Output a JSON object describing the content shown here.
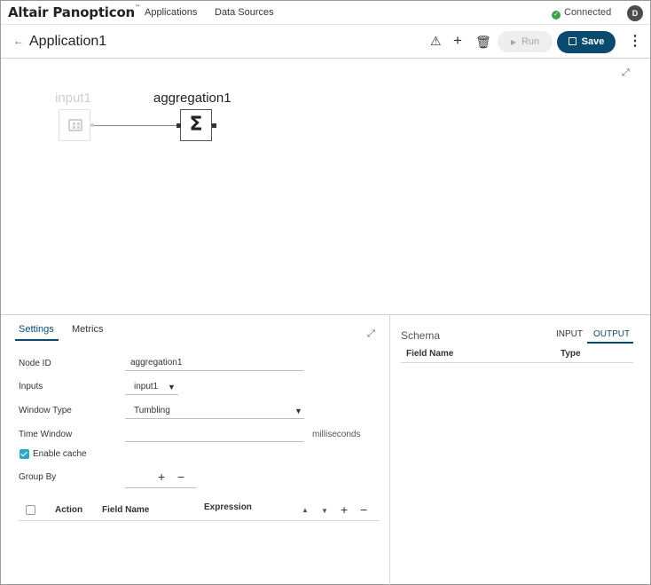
{
  "topbar": {
    "logo": "Altair Panopticon",
    "logo_mark": "™",
    "nav": [
      "Applications",
      "Data Sources"
    ],
    "status": "Connected",
    "user_initial": "D"
  },
  "appbar": {
    "back_icon": "arrow-left-icon",
    "title": "Application1",
    "run_label": "Run",
    "save_label": "Save"
  },
  "canvas": {
    "nodes": [
      {
        "label": "input1",
        "icon": "table-grid-icon",
        "state": "disabled"
      },
      {
        "label": "aggregation1",
        "icon": "sigma-icon",
        "state": "selected"
      }
    ]
  },
  "settings": {
    "tabs": [
      "Settings",
      "Metrics"
    ],
    "active_tab": "Settings",
    "node_id_label": "Node ID",
    "node_id_value": "aggregation1",
    "inputs_label": "Inputs",
    "inputs_value": "input1",
    "window_type_label": "Window Type",
    "window_type_value": "Tumbling",
    "time_window_label": "Time Window",
    "time_window_value": "",
    "time_window_unit": "milliseconds",
    "enable_cache_label": "Enable cache",
    "enable_cache_checked": true,
    "group_by_label": "Group By",
    "table_headers": {
      "action": "Action",
      "field_name": "Field Name",
      "expression": "Expression"
    }
  },
  "schema": {
    "title": "Schema",
    "tabs": [
      "INPUT",
      "OUTPUT"
    ],
    "active_tab": "OUTPUT",
    "headers": {
      "field_name": "Field Name",
      "type": "Type"
    }
  },
  "colors": {
    "accent": "#0b4a6f",
    "connected": "#3aa24a",
    "checkbox": "#2fa6c8"
  }
}
